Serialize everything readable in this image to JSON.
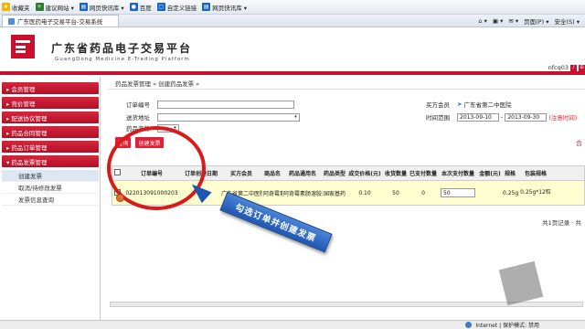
{
  "browser": {
    "favorites": [
      {
        "label": "收藏夹",
        "icon": "star-icon",
        "color": "#f0b400"
      },
      {
        "label": "建议网站 ▾",
        "icon": "suggest-icon",
        "color": "#2e7d32"
      },
      {
        "label": "网页快讯库 ▾",
        "icon": "feed-icon",
        "color": "#1565c0"
      },
      {
        "label": "百度",
        "icon": "baidu-icon",
        "color": "#1e63d0"
      },
      {
        "label": "自定义链接",
        "icon": "page-icon",
        "color": "#1565c0"
      },
      {
        "label": "网页快讯库 ▾",
        "icon": "feed-icon",
        "color": "#1565c0"
      }
    ],
    "tab_title": "广东医药电子交易平台-交易系统",
    "tools": [
      "⌂ ▾",
      "▣ ▾",
      "✉ ▾",
      "页面(P) ▾",
      "安全(S) ▾"
    ]
  },
  "header": {
    "title": "广东省药品电子交易平台",
    "subtitle": "GuangDong Medicine E-Trading Platform",
    "user": "nfcq03",
    "user_icons": [
      "♪",
      "⊞"
    ]
  },
  "sidebar": {
    "items": [
      {
        "label": "▸ 会员管理"
      },
      {
        "label": "▸ 竞价管理"
      },
      {
        "label": "▸ 配送协议管理"
      },
      {
        "label": "▸ 药品合同管理"
      },
      {
        "label": "▸ 药品订单管理"
      },
      {
        "label": "▾ 药品发票管理"
      }
    ],
    "subitems": [
      {
        "label": "创建发票",
        "active": true
      },
      {
        "label": "取消/待修改发票",
        "active": false
      },
      {
        "label": "发票信息查询",
        "active": false
      }
    ]
  },
  "main": {
    "breadcrumb": "药品发票管理 » 创建药品发票 »",
    "form": {
      "order_no_label": "订单编号",
      "delivery_addr_label": "送货地址",
      "product_name_label": "药品名称",
      "buyer_label": "买方会员",
      "buyer_value": "广东省第二中医院",
      "time_label": "时间范围",
      "date_from": "2013-09-10",
      "date_to": "2013-09-30",
      "date_note": "(注意时间)"
    },
    "query_button": "查询",
    "create_button": "创建发票",
    "right_mark": "合",
    "table": {
      "columns": [
        "",
        "订单编号",
        "订单创建日期",
        "买方会员",
        "商品名",
        "药品通用名",
        "药品类型",
        "成交价格(元)",
        "收货数量",
        "已支付数量",
        "本次支付数量",
        "金额(元)",
        "规格",
        "包装规格"
      ],
      "rows": [
        [
          "",
          "022013091000203",
          ".10",
          "广东省第二中医院",
          "阿奇霉素",
          "阿奇霉素肠溶胶囊",
          "国家基药",
          "0.10",
          "50",
          "0",
          "50",
          "",
          "0.25g",
          "0.25g*12粒"
        ]
      ]
    },
    "pager": "共1页记录 · 共"
  },
  "annotation": {
    "callout": "勾选订单并创建发票"
  },
  "status": {
    "zone": "Internet | 保护模式: 禁用"
  }
}
